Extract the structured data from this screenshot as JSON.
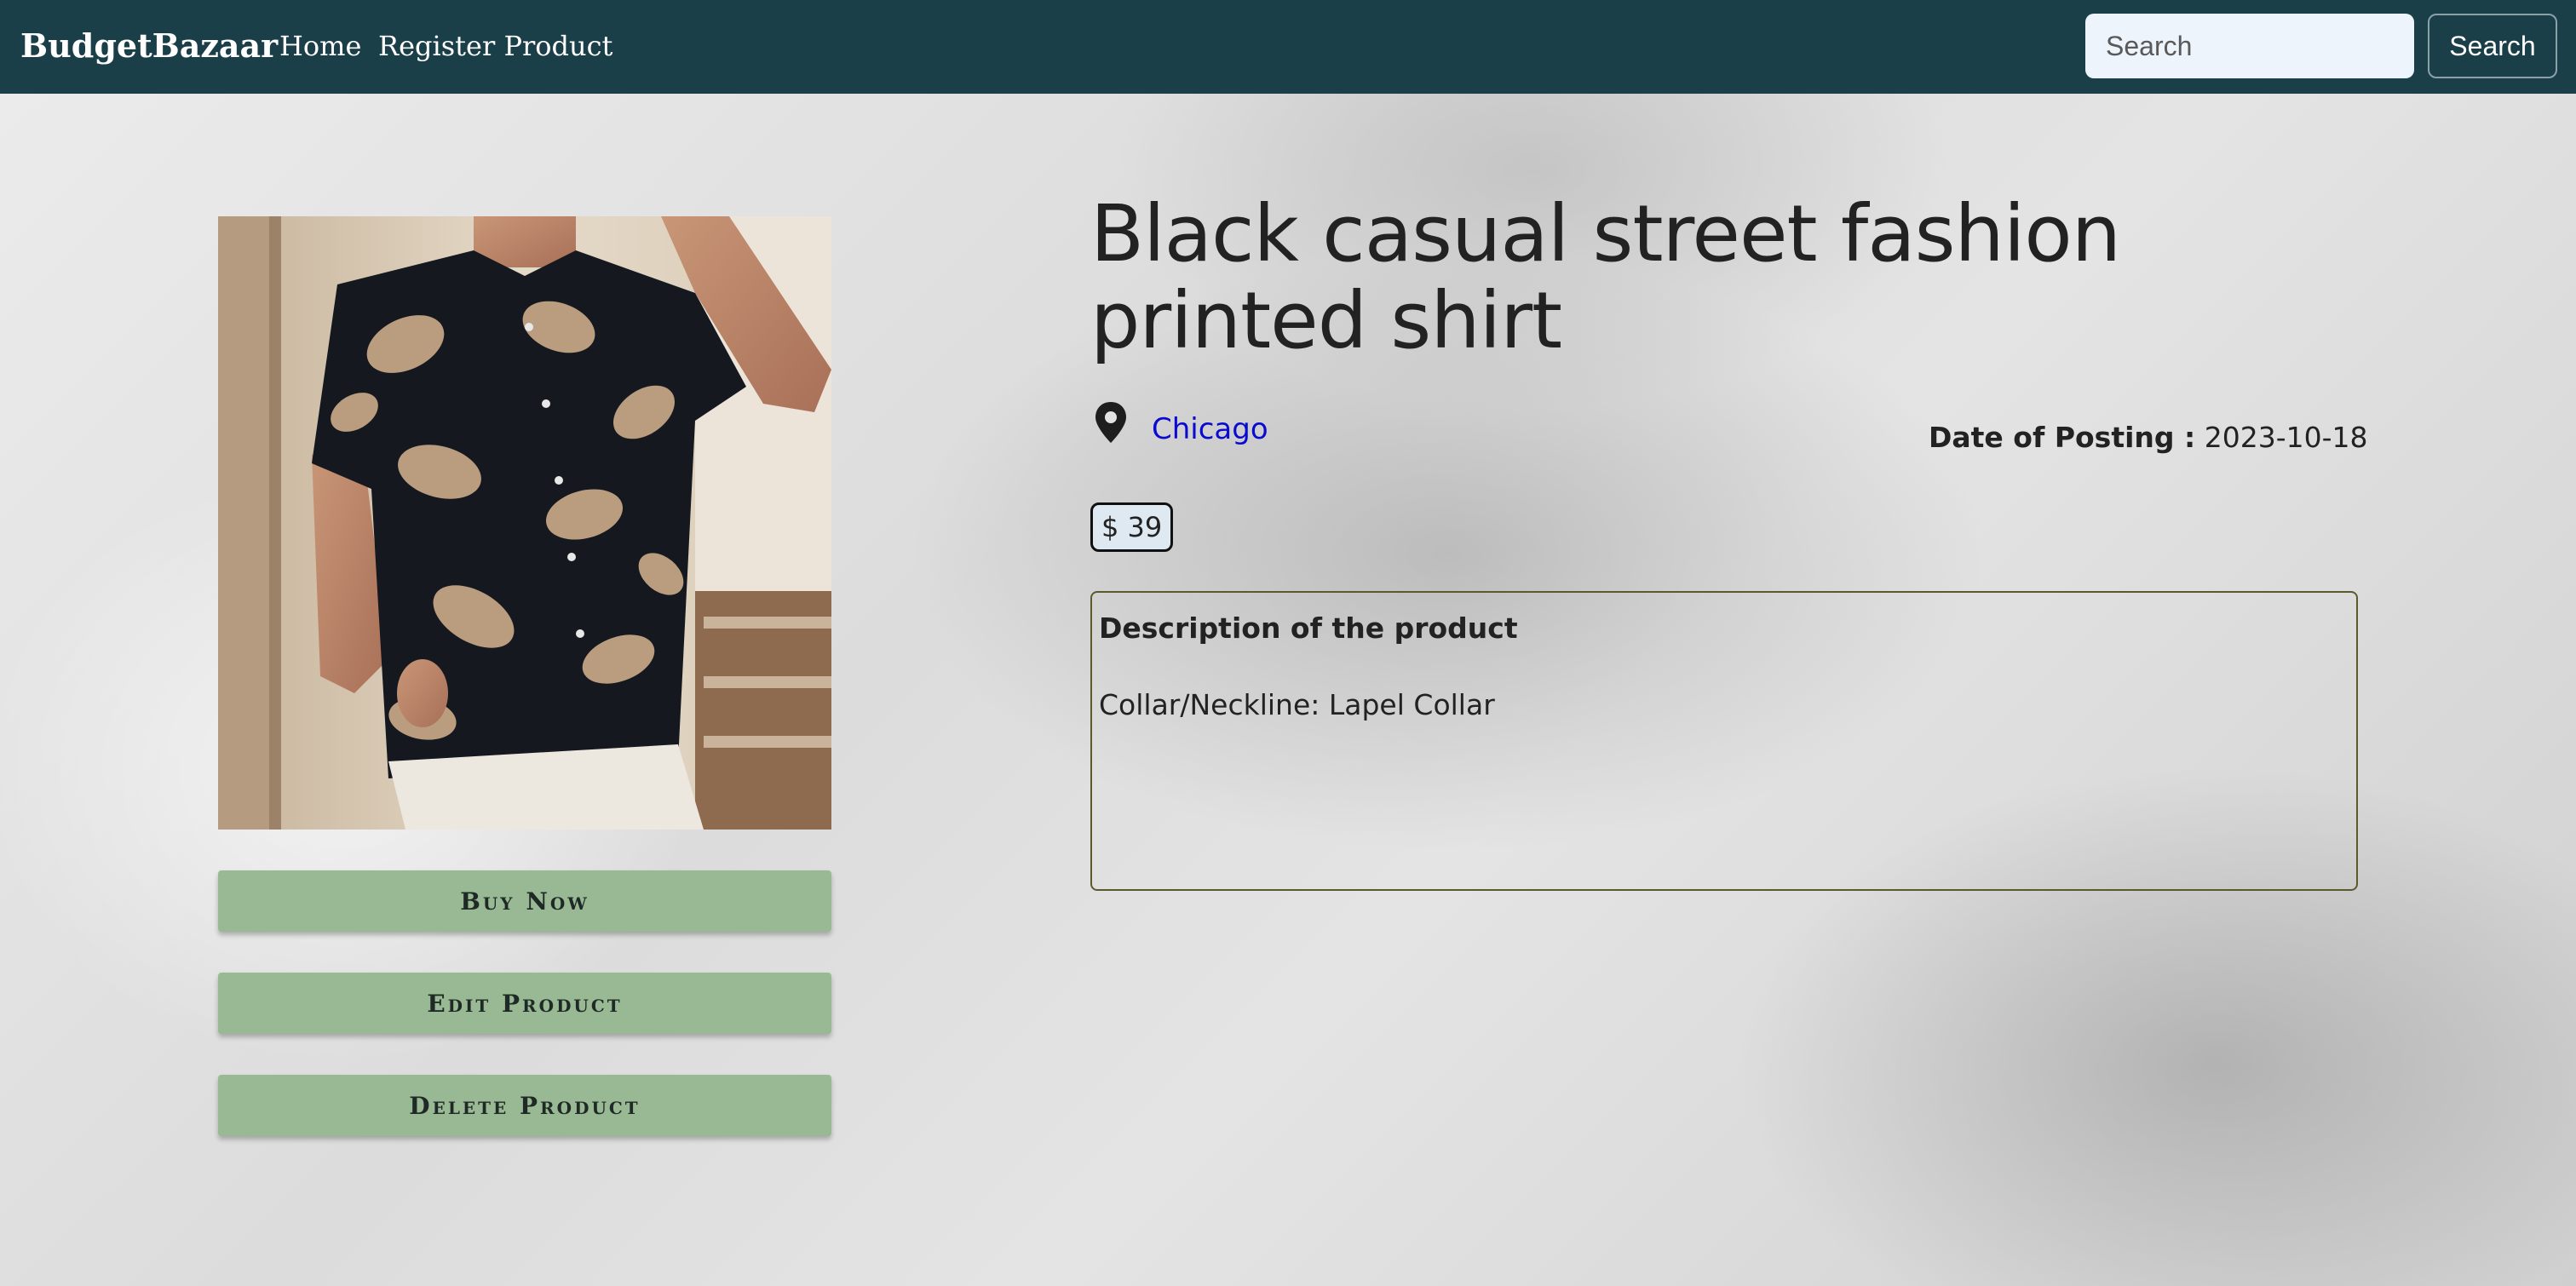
{
  "navbar": {
    "brand": "BudgetBazaar",
    "links": [
      "Home",
      "Register Product"
    ],
    "search_placeholder": "Search",
    "search_button": "Search"
  },
  "product": {
    "title": "Black casual street fashion printed shirt",
    "location": "Chicago",
    "date_label": "Date of Posting :",
    "date_value": "2023-10-18",
    "price": "$ 39",
    "description_heading": "Description of the product",
    "description": "Collar/Neckline: Lapel Collar"
  },
  "actions": {
    "buy": "Buy Now",
    "edit": "Edit Product",
    "delete": "Delete Product"
  },
  "colors": {
    "navbar": "#1b3f48",
    "button": "#98b994",
    "location_link": "#0a0ad0"
  }
}
